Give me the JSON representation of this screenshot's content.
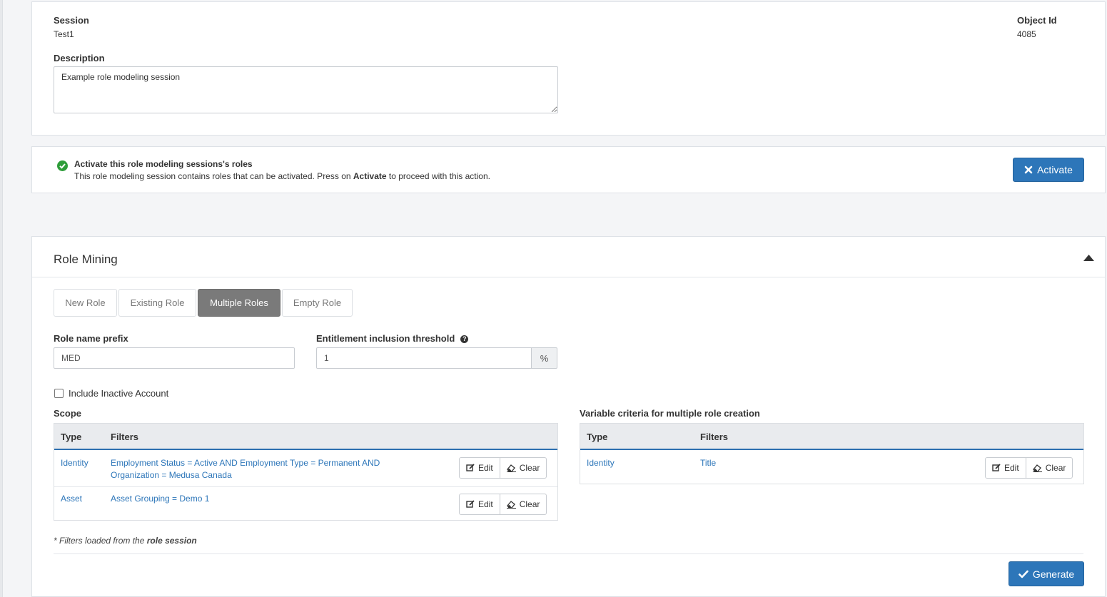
{
  "session": {
    "session_label": "Session",
    "session_value": "Test1",
    "object_id_label": "Object Id",
    "object_id_value": "4085",
    "description_label": "Description",
    "description_value": "Example role modeling session"
  },
  "activation": {
    "title": "Activate this role modeling sessions's roles",
    "message_before": "This role modeling session contains roles that can be activated. Press on ",
    "message_bold": "Activate",
    "message_after": " to proceed with this action.",
    "activate_button": "Activate"
  },
  "role_mining": {
    "title": "Role Mining",
    "tabs": [
      {
        "label": "New Role",
        "active": false
      },
      {
        "label": "Existing Role",
        "active": false
      },
      {
        "label": "Multiple Roles",
        "active": true
      },
      {
        "label": "Empty Role",
        "active": false
      }
    ],
    "prefix_label": "Role name prefix",
    "prefix_value": "MED",
    "threshold_label": "Entitlement inclusion threshold",
    "threshold_value": "1",
    "threshold_unit": "%",
    "include_inactive_label": "Include Inactive Account",
    "include_inactive_checked": false,
    "scope": {
      "title": "Scope",
      "headers": [
        "Type",
        "Filters"
      ],
      "rows": [
        {
          "type": "Identity",
          "filters_line1": "Employment Status = Active AND Employment Type = Permanent AND",
          "filters_line2": "Organization = Medusa Canada"
        },
        {
          "type": "Asset",
          "filters_line1": "Asset Grouping = Demo 1",
          "filters_line2": ""
        }
      ]
    },
    "variable": {
      "title": "Variable criteria for multiple role creation",
      "headers": [
        "Type",
        "Filters"
      ],
      "rows": [
        {
          "type": "Identity",
          "filters": "Title"
        }
      ]
    },
    "edit_label": "Edit",
    "clear_label": "Clear",
    "note_before": "* Filters loaded from the ",
    "note_bold": "role session",
    "generate_button": "Generate"
  },
  "colors": {
    "primary": "#2d76b9",
    "success": "#2e9d3a",
    "tab_active": "#7a7a7a"
  }
}
